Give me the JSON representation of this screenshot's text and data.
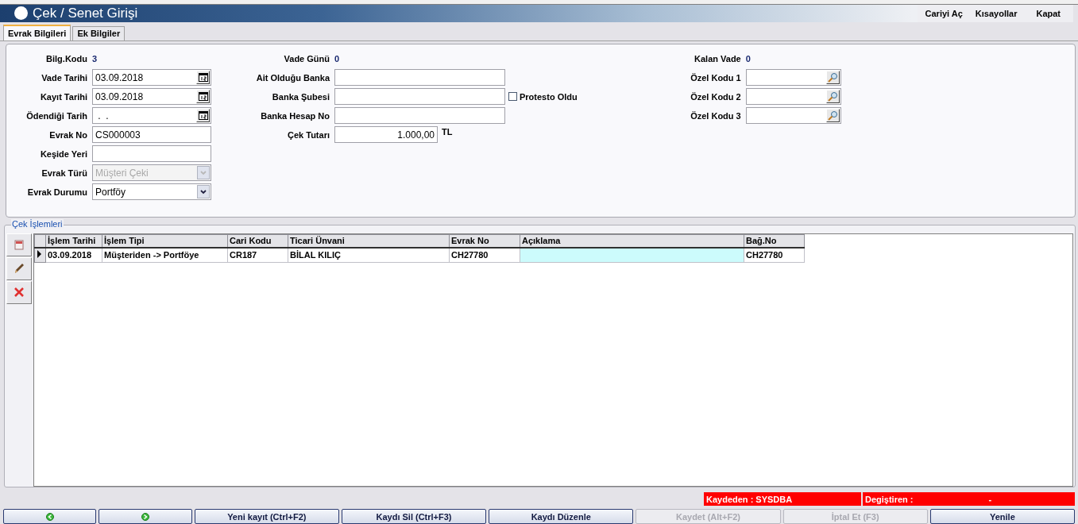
{
  "window": {
    "title": "Çek / Senet Girişi"
  },
  "menu": [
    {
      "label": "Cariyi Aç"
    },
    {
      "label": "Kısayollar"
    },
    {
      "label": "Kapat"
    }
  ],
  "tabs": [
    {
      "label": "Evrak Bilgileri",
      "selected": true
    },
    {
      "label": "Ek Bilgiler",
      "selected": false
    }
  ],
  "form": {
    "columns": [
      [
        {
          "kind": "value",
          "label": "Bilg.Kodu",
          "value": "3"
        },
        {
          "kind": "date",
          "label": "Vade Tarihi",
          "value": "03.09.2018"
        },
        {
          "kind": "date",
          "label": "Kayıt Tarihi",
          "value": "03.09.2018"
        },
        {
          "kind": "date",
          "label": "Ödendiği Tarih",
          "value": " .  ."
        },
        {
          "kind": "text",
          "label": "Evrak No",
          "value": "CS000003"
        },
        {
          "kind": "text",
          "label": "Keşide Yeri"
        },
        {
          "kind": "select",
          "label": "Evrak Türü",
          "value": "Müşteri Çeki",
          "disabled": true
        },
        {
          "kind": "select",
          "label": "Evrak Durumu",
          "value": "Portföy",
          "disabled": false
        }
      ],
      [
        {
          "kind": "value",
          "label": "Vade Günü",
          "value": "0"
        },
        {
          "kind": "text",
          "label": "Ait Olduğu Banka"
        },
        {
          "kind": "text",
          "label": "Banka Şubesi",
          "checkbox": {
            "label": "Protesto Oldu",
            "checked": false
          }
        },
        {
          "kind": "text",
          "label": "Banka Hesap No"
        },
        {
          "kind": "number",
          "label": "Çek Tutarı",
          "value": "1.000,00",
          "unit": "TL"
        }
      ],
      [
        {
          "kind": "value",
          "label": "Kalan Vade",
          "value": "0"
        },
        {
          "kind": "lookup",
          "label": "Özel Kodu 1"
        },
        {
          "kind": "lookup",
          "label": "Özel Kodu 2"
        },
        {
          "kind": "lookup",
          "label": "Özel Kodu 3"
        }
      ]
    ]
  },
  "operations": {
    "title": "Çek İşlemleri",
    "columns": [
      "İşlem Tarihi",
      "İşlem Tipi",
      "Cari Kodu",
      "Ticari Ünvani",
      "Evrak No",
      "Açıklama",
      "Bağ.No"
    ],
    "rows": [
      {
        "selected": true,
        "cells": [
          {
            "text": "03.09.2018",
            "focused": false
          },
          {
            "text": "Müşteriden -> Portföye",
            "focused": false
          },
          {
            "text": "CR187",
            "focused": false
          },
          {
            "text": "BİLAL KILIÇ",
            "focused": false
          },
          {
            "text": "CH27780",
            "focused": false
          },
          {
            "focused": true
          },
          {
            "text": "CH27780",
            "focused": false
          }
        ]
      }
    ]
  },
  "status_bar": {
    "saved_by": "Kaydeden : SYSDBA",
    "changed_by": "Degiştiren :",
    "changed_by_value": "-"
  },
  "buttons": [
    {
      "kind": "back",
      "disabled": false
    },
    {
      "kind": "forward",
      "disabled": false
    },
    {
      "kind": "text",
      "label": "Yeni kayıt (Ctrl+F2)",
      "disabled": false
    },
    {
      "kind": "text",
      "label": "Kaydı Sil (Ctrl+F3)",
      "disabled": false
    },
    {
      "kind": "text",
      "label": "Kaydı Düzenle",
      "disabled": false
    },
    {
      "kind": "text",
      "label": "Kaydet (Alt+F2)",
      "disabled": true
    },
    {
      "kind": "text",
      "label": "İptal Et (F3)",
      "disabled": true
    },
    {
      "kind": "text",
      "label": "Yenile",
      "disabled": false
    }
  ]
}
